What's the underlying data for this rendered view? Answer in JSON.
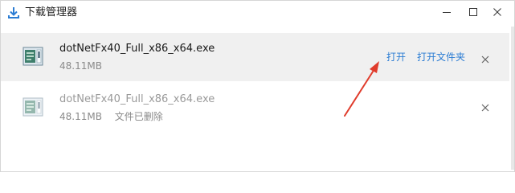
{
  "window": {
    "title": "下载管理器",
    "icons": {
      "app": "download-arrow-icon",
      "minimize": "minimize-icon",
      "maximize": "maximize-icon",
      "close": "close-icon"
    }
  },
  "downloads": [
    {
      "file_name": "dotNetFx40_Full_x86_x64.exe",
      "size": "48.11MB",
      "status": "",
      "actions": {
        "open": "打开",
        "open_folder": "打开文件夹"
      },
      "state": "completed",
      "icon": "installer-file-icon"
    },
    {
      "file_name": "dotNetFx40_Full_x86_x64.exe",
      "size": "48.11MB",
      "status": "文件已删除",
      "state": "deleted",
      "icon": "installer-file-icon"
    }
  ],
  "annotation": {
    "arrow_color": "#e03c2c",
    "points_to": "open"
  },
  "colors": {
    "link": "#2b7cd3",
    "row_hover": "#f0f0f0",
    "muted_text": "#8a8a8a"
  }
}
